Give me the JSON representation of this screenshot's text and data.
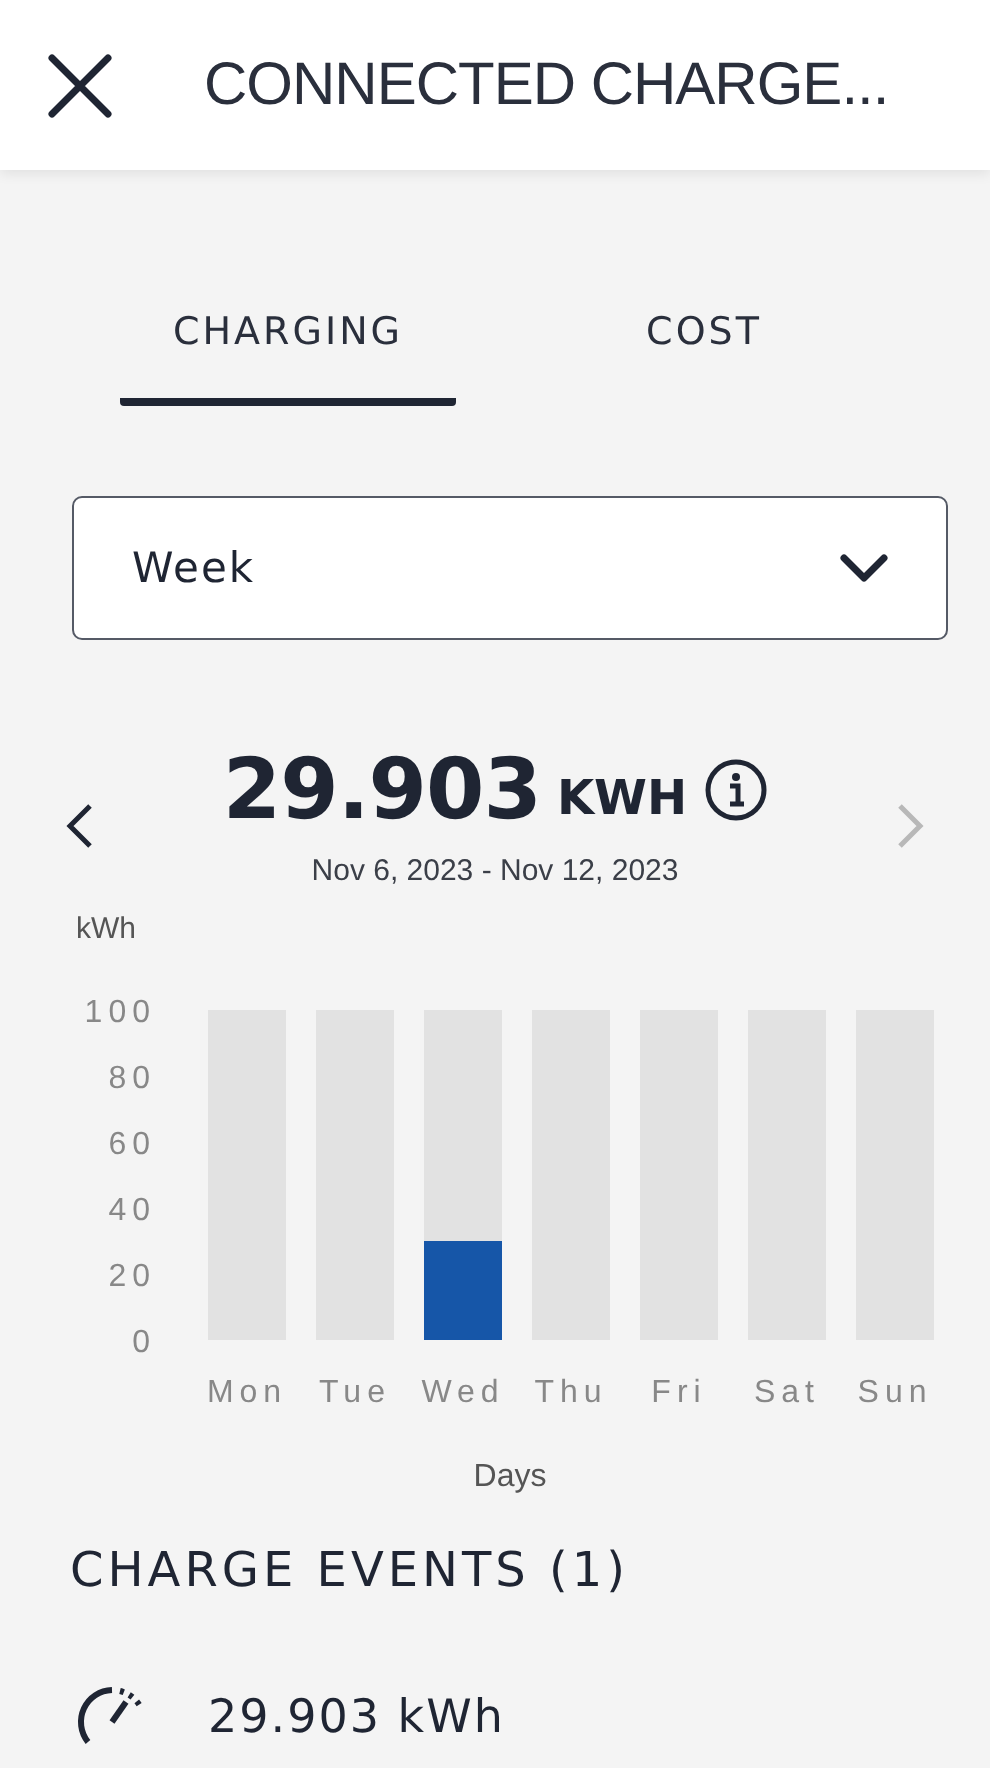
{
  "header": {
    "title": "CONNECTED CHARGE..."
  },
  "tabs": [
    {
      "label": "CHARGING",
      "selected": true
    },
    {
      "label": "COST",
      "selected": false
    }
  ],
  "period_select": {
    "value": "Week"
  },
  "summary": {
    "value": "29.903",
    "unit": "KWH",
    "date_range": "Nov 6, 2023 - Nov 12, 2023",
    "next_disabled": true
  },
  "chart_data": {
    "type": "bar",
    "ylabel": "kWh",
    "xlabel": "Days",
    "categories": [
      "Mon",
      "Tue",
      "Wed",
      "Thu",
      "Fri",
      "Sat",
      "Sun"
    ],
    "series": [
      {
        "color": "#1656a8",
        "values": [
          0,
          0,
          30,
          0,
          0,
          0,
          0
        ]
      },
      {
        "color": "#e2e2e2",
        "values": [
          100,
          100,
          100,
          100,
          100,
          100,
          100
        ]
      }
    ],
    "ylim": [
      0,
      100
    ],
    "yticks": [
      0,
      20,
      40,
      60,
      80,
      100
    ]
  },
  "charge_events": {
    "title": "CHARGE EVENTS (1)",
    "items": [
      {
        "energy": "29.903 kWh"
      }
    ]
  }
}
